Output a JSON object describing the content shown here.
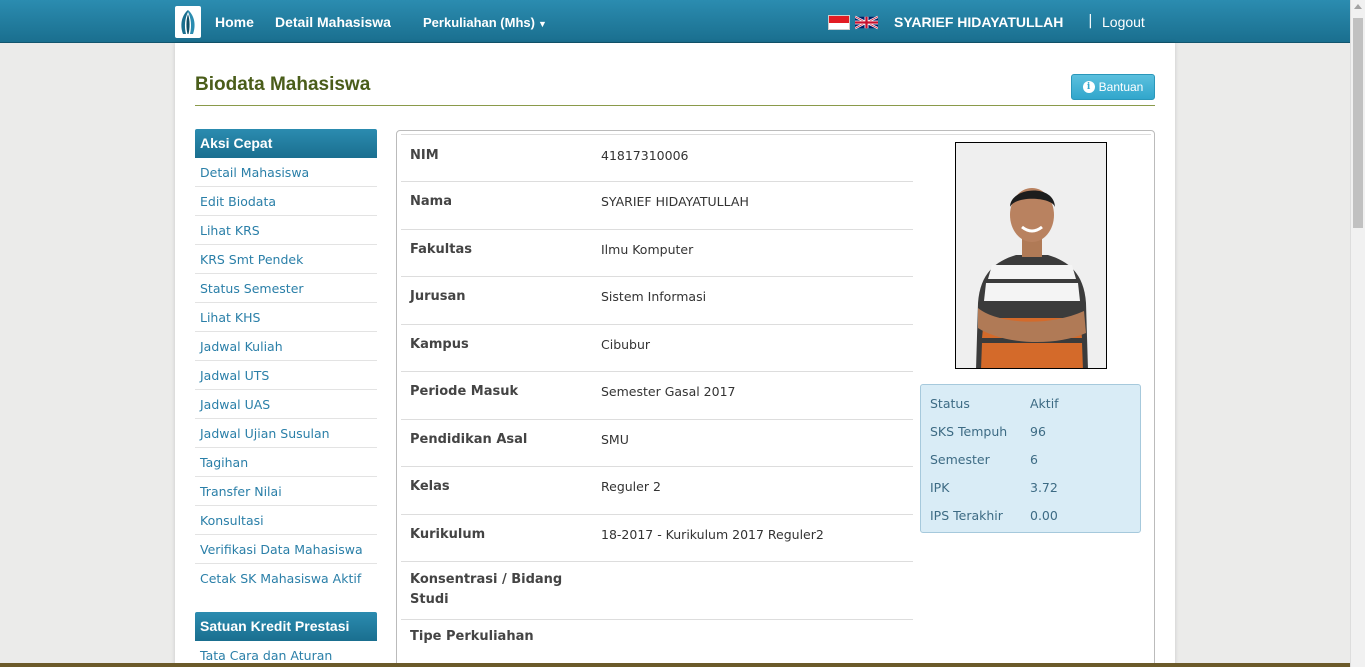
{
  "navbar": {
    "home": "Home",
    "detail": "Detail Mahasiswa",
    "kuliah": "Perkuliahan (Mhs)",
    "user_name": "SYARIEF HIDAYATULLAH",
    "separator": "|",
    "logout": "Logout"
  },
  "page": {
    "title": "Biodata Mahasiswa",
    "help_label": "Bantuan"
  },
  "sidebar": {
    "quick_title": "Aksi Cepat",
    "quick_items": [
      "Detail Mahasiswa",
      "Edit Biodata",
      "Lihat KRS",
      "KRS Smt Pendek",
      "Status Semester",
      "Lihat KHS",
      "Jadwal Kuliah",
      "Jadwal UTS",
      "Jadwal UAS",
      "Jadwal Ujian Susulan",
      "Tagihan",
      "Transfer Nilai",
      "Konsultasi",
      "Verifikasi Data Mahasiswa",
      "Cetak SK Mahasiswa Aktif"
    ],
    "skp_title": "Satuan Kredit Prestasi",
    "skp_items": [
      "Tata Cara dan Aturan"
    ]
  },
  "biodata": [
    {
      "label": "NIM",
      "value": "41817310006"
    },
    {
      "label": "Nama",
      "value": "SYARIEF HIDAYATULLAH"
    },
    {
      "label": "Fakultas",
      "value": "Ilmu Komputer"
    },
    {
      "label": "Jurusan",
      "value": "Sistem Informasi"
    },
    {
      "label": "Kampus",
      "value": "Cibubur"
    },
    {
      "label": "Periode Masuk",
      "value": "Semester Gasal 2017"
    },
    {
      "label": "Pendidikan Asal",
      "value": "SMU"
    },
    {
      "label": "Kelas",
      "value": "Reguler 2"
    },
    {
      "label": "Kurikulum",
      "value": "18-2017 - Kurikulum 2017 Reguler2"
    },
    {
      "label": "Konsentrasi / Bidang Studi",
      "value": ""
    },
    {
      "label": "Tipe Perkuliahan",
      "value": ""
    }
  ],
  "status": [
    {
      "label": "Status",
      "value": "Aktif"
    },
    {
      "label": "SKS Tempuh",
      "value": "96"
    },
    {
      "label": "Semester",
      "value": "6"
    },
    {
      "label": "IPK",
      "value": "3.72"
    },
    {
      "label": "IPS Terakhir",
      "value": "0.00"
    }
  ],
  "colors": {
    "nav": "#1a6f8f",
    "title": "#4a5d1a",
    "link": "#2a7fa8",
    "status_bg": "#d9ecf6"
  }
}
